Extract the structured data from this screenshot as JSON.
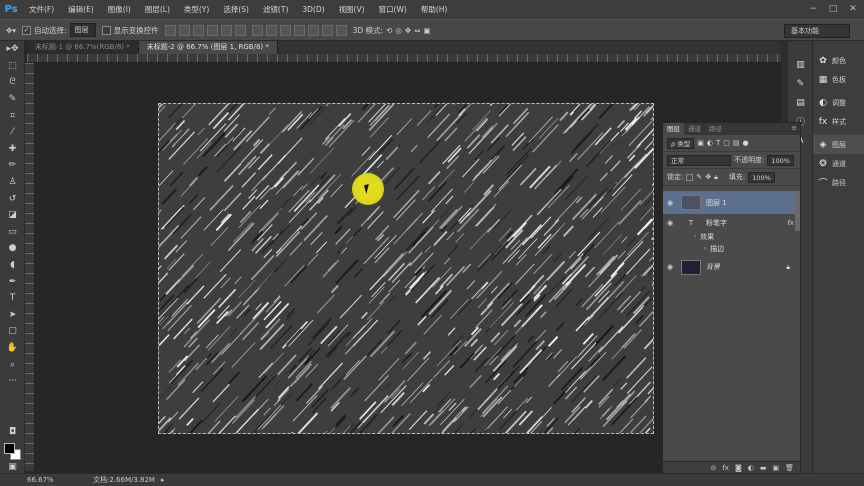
{
  "app": {
    "logo": "Ps"
  },
  "menu": [
    "文件(F)",
    "编辑(E)",
    "图像(I)",
    "图层(L)",
    "类型(Y)",
    "选择(S)",
    "滤镜(T)",
    "3D(D)",
    "视图(V)",
    "窗口(W)",
    "帮助(H)"
  ],
  "options": {
    "auto_select_label": "自动选择:",
    "auto_select_value": "图层",
    "show_transform_label": "显示变换控件",
    "mode_3d_label": "3D 模式:",
    "workspace": "基本功能"
  },
  "tabs": [
    {
      "label": "未标题-1 @ 66.7%(RGB/8) *",
      "active": false
    },
    {
      "label": "未标题-2 @ 66.7% (图层 1, RGB/8) *",
      "active": true
    }
  ],
  "layers_panel": {
    "tabs": [
      "图层",
      "通道",
      "路径"
    ],
    "filter_type": "ρ 类型",
    "blend_mode": "正常",
    "opacity_label": "不透明度:",
    "opacity_value": "100%",
    "lock_label": "锁定:",
    "fill_label": "填充:",
    "fill_value": "100%",
    "layers": [
      {
        "name": "图层 1",
        "selected": true,
        "thumb_color": "#4e5260"
      },
      {
        "name": "粉笔字",
        "type": "text",
        "fx": "fx"
      },
      {
        "name": "效果",
        "sub": true
      },
      {
        "name": "描边",
        "sub": true
      },
      {
        "name": "背景",
        "thumb_color": "#202038",
        "locked": true
      }
    ]
  },
  "dock": {
    "items": [
      "颜色",
      "色板",
      "调整",
      "样式",
      "图层",
      "通道",
      "路径"
    ]
  },
  "status": {
    "zoom": "66.67%",
    "doc_size": "文档:2.66M/3.82M"
  },
  "colors": {
    "foreground": "#000000",
    "background": "#ffffff",
    "highlight": "#e9e11a"
  }
}
